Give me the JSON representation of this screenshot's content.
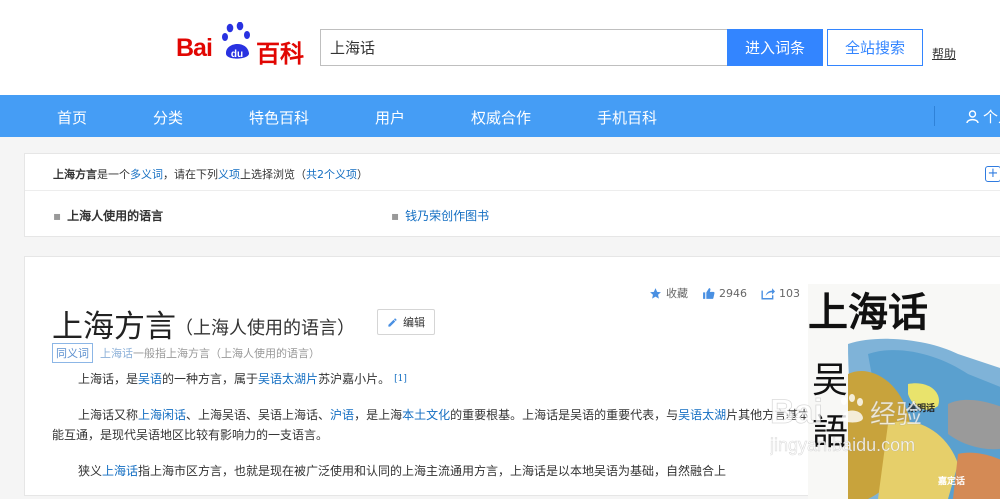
{
  "header": {
    "logo": {
      "part1": "Bai",
      "part2": "du",
      "part3": "百科",
      "brand_color": "#e10602"
    },
    "search": {
      "value": "上海话",
      "placeholder": ""
    },
    "enter_button": "进入词条",
    "site_search_button": "全站搜索",
    "help_link": "帮助"
  },
  "nav": {
    "items": [
      "首页",
      "分类",
      "特色百科",
      "用户",
      "权威合作",
      "手机百科"
    ],
    "user_label": "个人",
    "color": "#459df5"
  },
  "polysemy": {
    "term": "上海方言",
    "intro_1": "是一个",
    "polysemy_word": "多义词",
    "intro_2": "，请在下列",
    "item_word": "义项",
    "intro_3": "上选择浏览（",
    "count_text": "共2个义项",
    "intro_4": "）",
    "options": [
      "上海人使用的语言",
      "钱乃荣创作图书"
    ],
    "expand_icon": "plus-icon"
  },
  "article": {
    "title": "上海方言",
    "subtitle": "（上海人使用的语言）",
    "edit_label": "编辑",
    "collect_label": "收藏",
    "likes": "2946",
    "shares": "103",
    "synonym_tag": "同义词",
    "synonym_link": "上海话",
    "synonym_text": "一般指上海方言（上海人使用的语言）",
    "p1": {
      "a": "上海话，是",
      "l1": "吴语",
      "b": "的一种方言，属于",
      "l2": "吴语太湖片",
      "c": "苏沪嘉小片。",
      "ref": "[1]"
    },
    "p2": {
      "a": "上海话又称",
      "l1": "上海闲话",
      "b": "、上海吴语、吴语上海话、",
      "l2": "沪语",
      "c": "，是上海",
      "l3": "本土文化",
      "d": "的重要根基。上海话是吴语的重要代表，与",
      "l4": "吴语太湖",
      "e": "片其他方言基本能互通，是现代吴语地区比较有影响力的一支语言。"
    },
    "p3": {
      "a": "狭义",
      "l1": "上海话",
      "b": "指上海市区方言，也就是现在被广泛使用和认同的上海主流通用方言，上海话是以本地吴语为基础，自然融合上"
    }
  },
  "image": {
    "big_text": "上海话",
    "side_text": "吴語",
    "label_chongming": "崇明话",
    "label_jiading": "嘉定话"
  },
  "watermark": {
    "brand": "Bai",
    "brand_cn": "经验",
    "url": "jingyan.baidu.com"
  }
}
